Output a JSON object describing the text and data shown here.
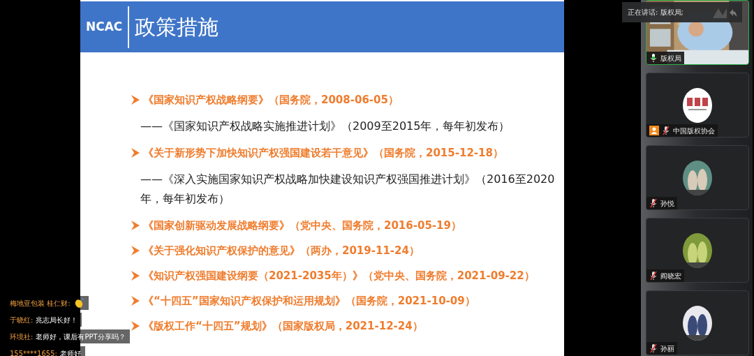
{
  "slide": {
    "logo": "NCAC",
    "title": "政策措施",
    "items": [
      {
        "kind": "main",
        "text": "《国家知识产权战略纲要》（国务院，2008-06-05）"
      },
      {
        "kind": "sub",
        "text": "——《国家知识产权战略实施推进计划》（2009至2015年，每年初发布）"
      },
      {
        "kind": "main",
        "text": "《关于新形势下加快知识产权强国建设若干意见》（国务院，2015-12-18）"
      },
      {
        "kind": "sub",
        "text": "——《深入实施国家知识产权战略加快建设知识产权强国推进计划》（2016至2020年，每年初发布）"
      },
      {
        "kind": "main",
        "text": "《国家创新驱动发展战略纲要》（党中央、国务院，2016-05-19）"
      },
      {
        "kind": "main",
        "text": "《关于强化知识产权保护的意见》（两办，2019-11-24）"
      },
      {
        "kind": "main",
        "text": "《知识产权强国建设纲要（2021-2035年）》（党中央、国务院，2021-09-22）"
      },
      {
        "kind": "main",
        "text": "《“十四五”国家知识产权保护和运用规划》（国务院，2021-10-09）"
      },
      {
        "kind": "main",
        "text": "《版权工作“十四五”规划》（国家版权局，2021-12-24）"
      }
    ]
  },
  "speaking": {
    "label": "正在讲话: 版权局;"
  },
  "participants": [
    {
      "kind": "video",
      "name": "版权局",
      "muted": false,
      "speaking": true,
      "host": false
    },
    {
      "kind": "logo",
      "name": "中国版权协会",
      "muted": true,
      "speaking": false,
      "host": true
    },
    {
      "kind": "cats",
      "name": "孙悦",
      "muted": true,
      "speaking": false,
      "host": false
    },
    {
      "kind": "trees",
      "name": "阎晓宏",
      "muted": true,
      "speaking": false,
      "host": false
    },
    {
      "kind": "figure",
      "name": "孙丽",
      "muted": true,
      "speaking": false,
      "host": false
    }
  ],
  "chat": [
    {
      "name": "梅地亚包装 桂仁财:",
      "kind": "clap"
    },
    {
      "name": "于晓红:",
      "message": "兆志局长好！",
      "kind": "text"
    },
    {
      "name": "环境社:",
      "message": "老师好，课后有PPT分享吗？",
      "kind": "text"
    },
    {
      "name": "155****1655:",
      "message": "老师好",
      "kind": "text"
    }
  ]
}
